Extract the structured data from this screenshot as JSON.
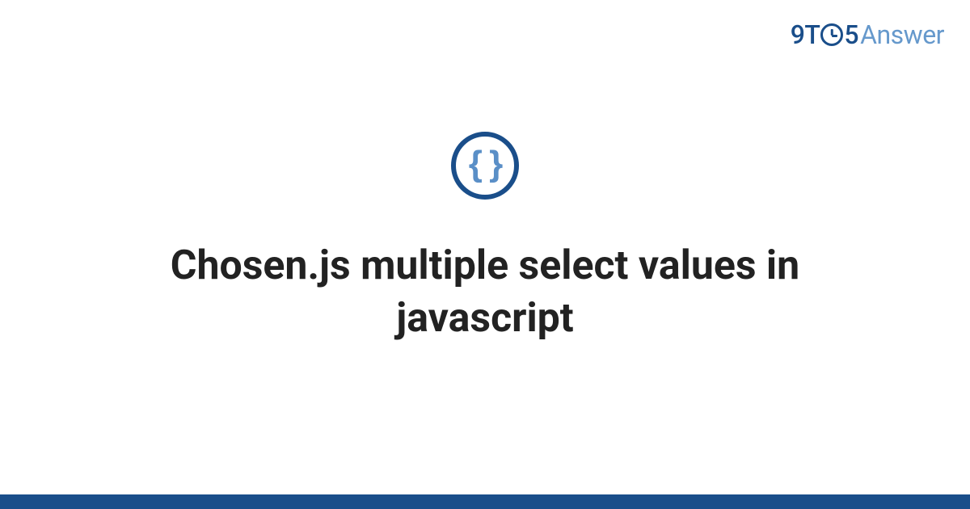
{
  "logo": {
    "part1": "9T",
    "part2": "5",
    "part3": "Answer"
  },
  "icon": {
    "braces": "{ }"
  },
  "title": "Chosen.js multiple select values in javascript"
}
